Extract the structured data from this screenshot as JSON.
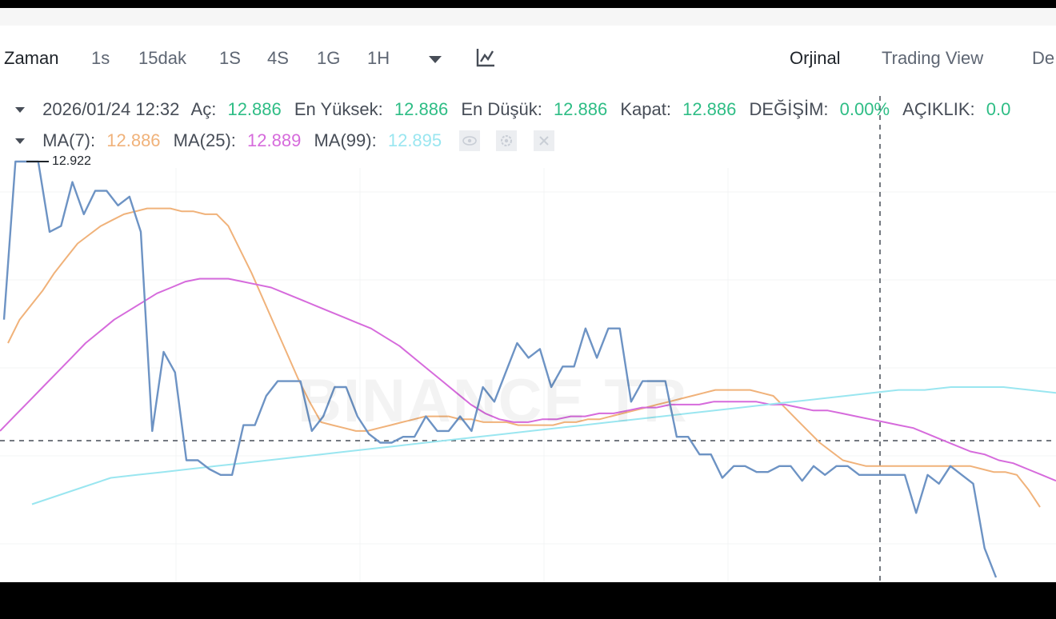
{
  "toolbar": {
    "time_label": "Zaman",
    "intervals": [
      "1s",
      "15dak",
      "1S",
      "4S",
      "1G",
      "1H"
    ],
    "views": [
      "Orjinal",
      "Trading View",
      "De"
    ]
  },
  "ohlc": {
    "datetime": "2026/01/24 12:32",
    "open_label": "Aç:",
    "open": "12.886",
    "high_label": "En Yüksek:",
    "high": "12.886",
    "low_label": "En Düşük:",
    "low": "12.886",
    "close_label": "Kapat:",
    "close": "12.886",
    "change_label": "DEĞİŞİM:",
    "change": "0.00%",
    "range_label": "AÇIKLIK:",
    "range": "0.0"
  },
  "ma": {
    "ma7_label": "MA(7):",
    "ma7": "12.886",
    "ma25_label": "MA(25):",
    "ma25": "12.889",
    "ma99_label": "MA(99):",
    "ma99": "12.895"
  },
  "watermark": "BINANCE TR",
  "colors": {
    "price": "#6d93c4",
    "ma7": "#f0b27a",
    "ma25": "#d66bdc",
    "ma99": "#9ae6f0",
    "positive": "#2ebd85"
  },
  "chart_data": {
    "type": "line",
    "title": "",
    "max_label": "12.922",
    "series": [
      {
        "name": "MA(7)",
        "values": [
          12.86,
          12.868,
          12.873,
          12.878,
          12.884,
          12.889,
          12.894,
          12.897,
          12.9,
          12.902,
          12.904,
          12.905,
          12.906,
          12.906,
          12.906,
          12.905,
          12.905,
          12.904,
          12.904,
          12.9,
          12.892,
          12.884,
          12.875,
          12.866,
          12.857,
          12.848,
          12.84,
          12.833,
          12.832,
          12.831,
          12.83,
          12.83,
          12.831,
          12.832,
          12.833,
          12.834,
          12.835,
          12.835,
          12.835,
          12.834,
          12.834,
          12.833,
          12.833,
          12.833,
          12.832,
          12.832,
          12.832,
          12.832,
          12.833,
          12.833,
          12.834,
          12.834,
          12.835,
          12.836,
          12.837,
          12.838,
          12.839,
          12.84,
          12.841,
          12.842,
          12.843,
          12.844,
          12.844,
          12.844,
          12.844,
          12.843,
          12.842,
          12.838,
          12.834,
          12.83,
          12.826,
          12.823,
          12.82,
          12.819,
          12.818,
          12.818,
          12.818,
          12.818,
          12.818,
          12.818,
          12.818,
          12.818,
          12.818,
          12.818,
          12.817,
          12.816,
          12.816,
          12.815,
          12.81,
          12.804
        ]
      },
      {
        "name": "MA(25)",
        "values": [
          12.83,
          12.835,
          12.84,
          12.845,
          12.85,
          12.855,
          12.86,
          12.864,
          12.868,
          12.871,
          12.874,
          12.877,
          12.879,
          12.881,
          12.882,
          12.882,
          12.882,
          12.881,
          12.88,
          12.879,
          12.877,
          12.875,
          12.873,
          12.871,
          12.869,
          12.867,
          12.865,
          12.862,
          12.859,
          12.855,
          12.851,
          12.847,
          12.843,
          12.839,
          12.836,
          12.834,
          12.833,
          12.833,
          12.834,
          12.834,
          12.835,
          12.835,
          12.836,
          12.836,
          12.837,
          12.838,
          12.838,
          12.839,
          12.839,
          12.839,
          12.84,
          12.84,
          12.84,
          12.84,
          12.839,
          12.839,
          12.838,
          12.837,
          12.837,
          12.836,
          12.835,
          12.834,
          12.833,
          12.832,
          12.831,
          12.829,
          12.827,
          12.825,
          12.823,
          12.822,
          12.82,
          12.819,
          12.817,
          12.815,
          12.813
        ]
      },
      {
        "name": "MA(99)",
        "values": [
          12.805,
          12.808,
          12.811,
          12.814,
          12.815,
          12.816,
          12.817,
          12.818,
          12.819,
          12.82,
          12.821,
          12.822,
          12.823,
          12.824,
          12.825,
          12.826,
          12.827,
          12.828,
          12.829,
          12.83,
          12.831,
          12.832,
          12.833,
          12.834,
          12.835,
          12.836,
          12.837,
          12.838,
          12.839,
          12.84,
          12.841,
          12.842,
          12.843,
          12.844,
          12.844,
          12.845,
          12.845,
          12.845,
          12.844,
          12.843
        ]
      },
      {
        "name": "price",
        "values": [
          12.868,
          12.922,
          12.922,
          12.922,
          12.898,
          12.9,
          12.915,
          12.904,
          12.912,
          12.912,
          12.907,
          12.91,
          12.898,
          12.83,
          12.857,
          12.85,
          12.82,
          12.82,
          12.817,
          12.815,
          12.815,
          12.832,
          12.832,
          12.842,
          12.847,
          12.847,
          12.847,
          12.83,
          12.835,
          12.845,
          12.845,
          12.835,
          12.829,
          12.826,
          12.826,
          12.828,
          12.828,
          12.835,
          12.83,
          12.83,
          12.835,
          12.83,
          12.845,
          12.84,
          12.85,
          12.86,
          12.855,
          12.858,
          12.845,
          12.852,
          12.852,
          12.865,
          12.855,
          12.865,
          12.865,
          12.84,
          12.847,
          12.847,
          12.847,
          12.828,
          12.828,
          12.822,
          12.822,
          12.814,
          12.818,
          12.818,
          12.816,
          12.816,
          12.818,
          12.818,
          12.813,
          12.818,
          12.815,
          12.818,
          12.818,
          12.815,
          12.815,
          12.815,
          12.815,
          12.815,
          12.802,
          12.815,
          12.812,
          12.818,
          12.815,
          12.812,
          12.79,
          12.78
        ]
      }
    ]
  }
}
